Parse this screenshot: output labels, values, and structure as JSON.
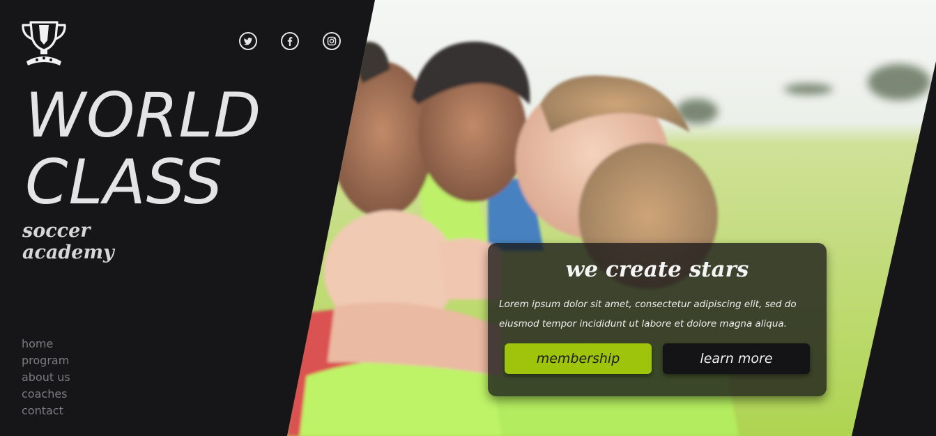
{
  "brand": {
    "title_lines": [
      "WORLD",
      "CLASS"
    ],
    "subtitle_lines": [
      "soccer",
      "academy"
    ],
    "logo_icon": "trophy-icon"
  },
  "social": [
    {
      "name": "twitter",
      "icon": "twitter-icon"
    },
    {
      "name": "facebook",
      "icon": "facebook-icon"
    },
    {
      "name": "instagram",
      "icon": "instagram-icon"
    }
  ],
  "nav": {
    "items": [
      "home",
      "program",
      "about us",
      "coaches",
      "contact"
    ]
  },
  "hero": {
    "image_alt": "",
    "card_title": "we create stars",
    "card_text": "Lorem ipsum dolor sit amet, consectetur adipiscing elit, sed do eiusmod tempor incididunt ut labore et dolore magna aliqua.",
    "primary_button": "membership",
    "secondary_button": "learn more"
  },
  "colors": {
    "background": "#161618",
    "accent": "#9ec40c",
    "text_light": "#e4e4e6",
    "nav_text": "#7c7c80"
  }
}
